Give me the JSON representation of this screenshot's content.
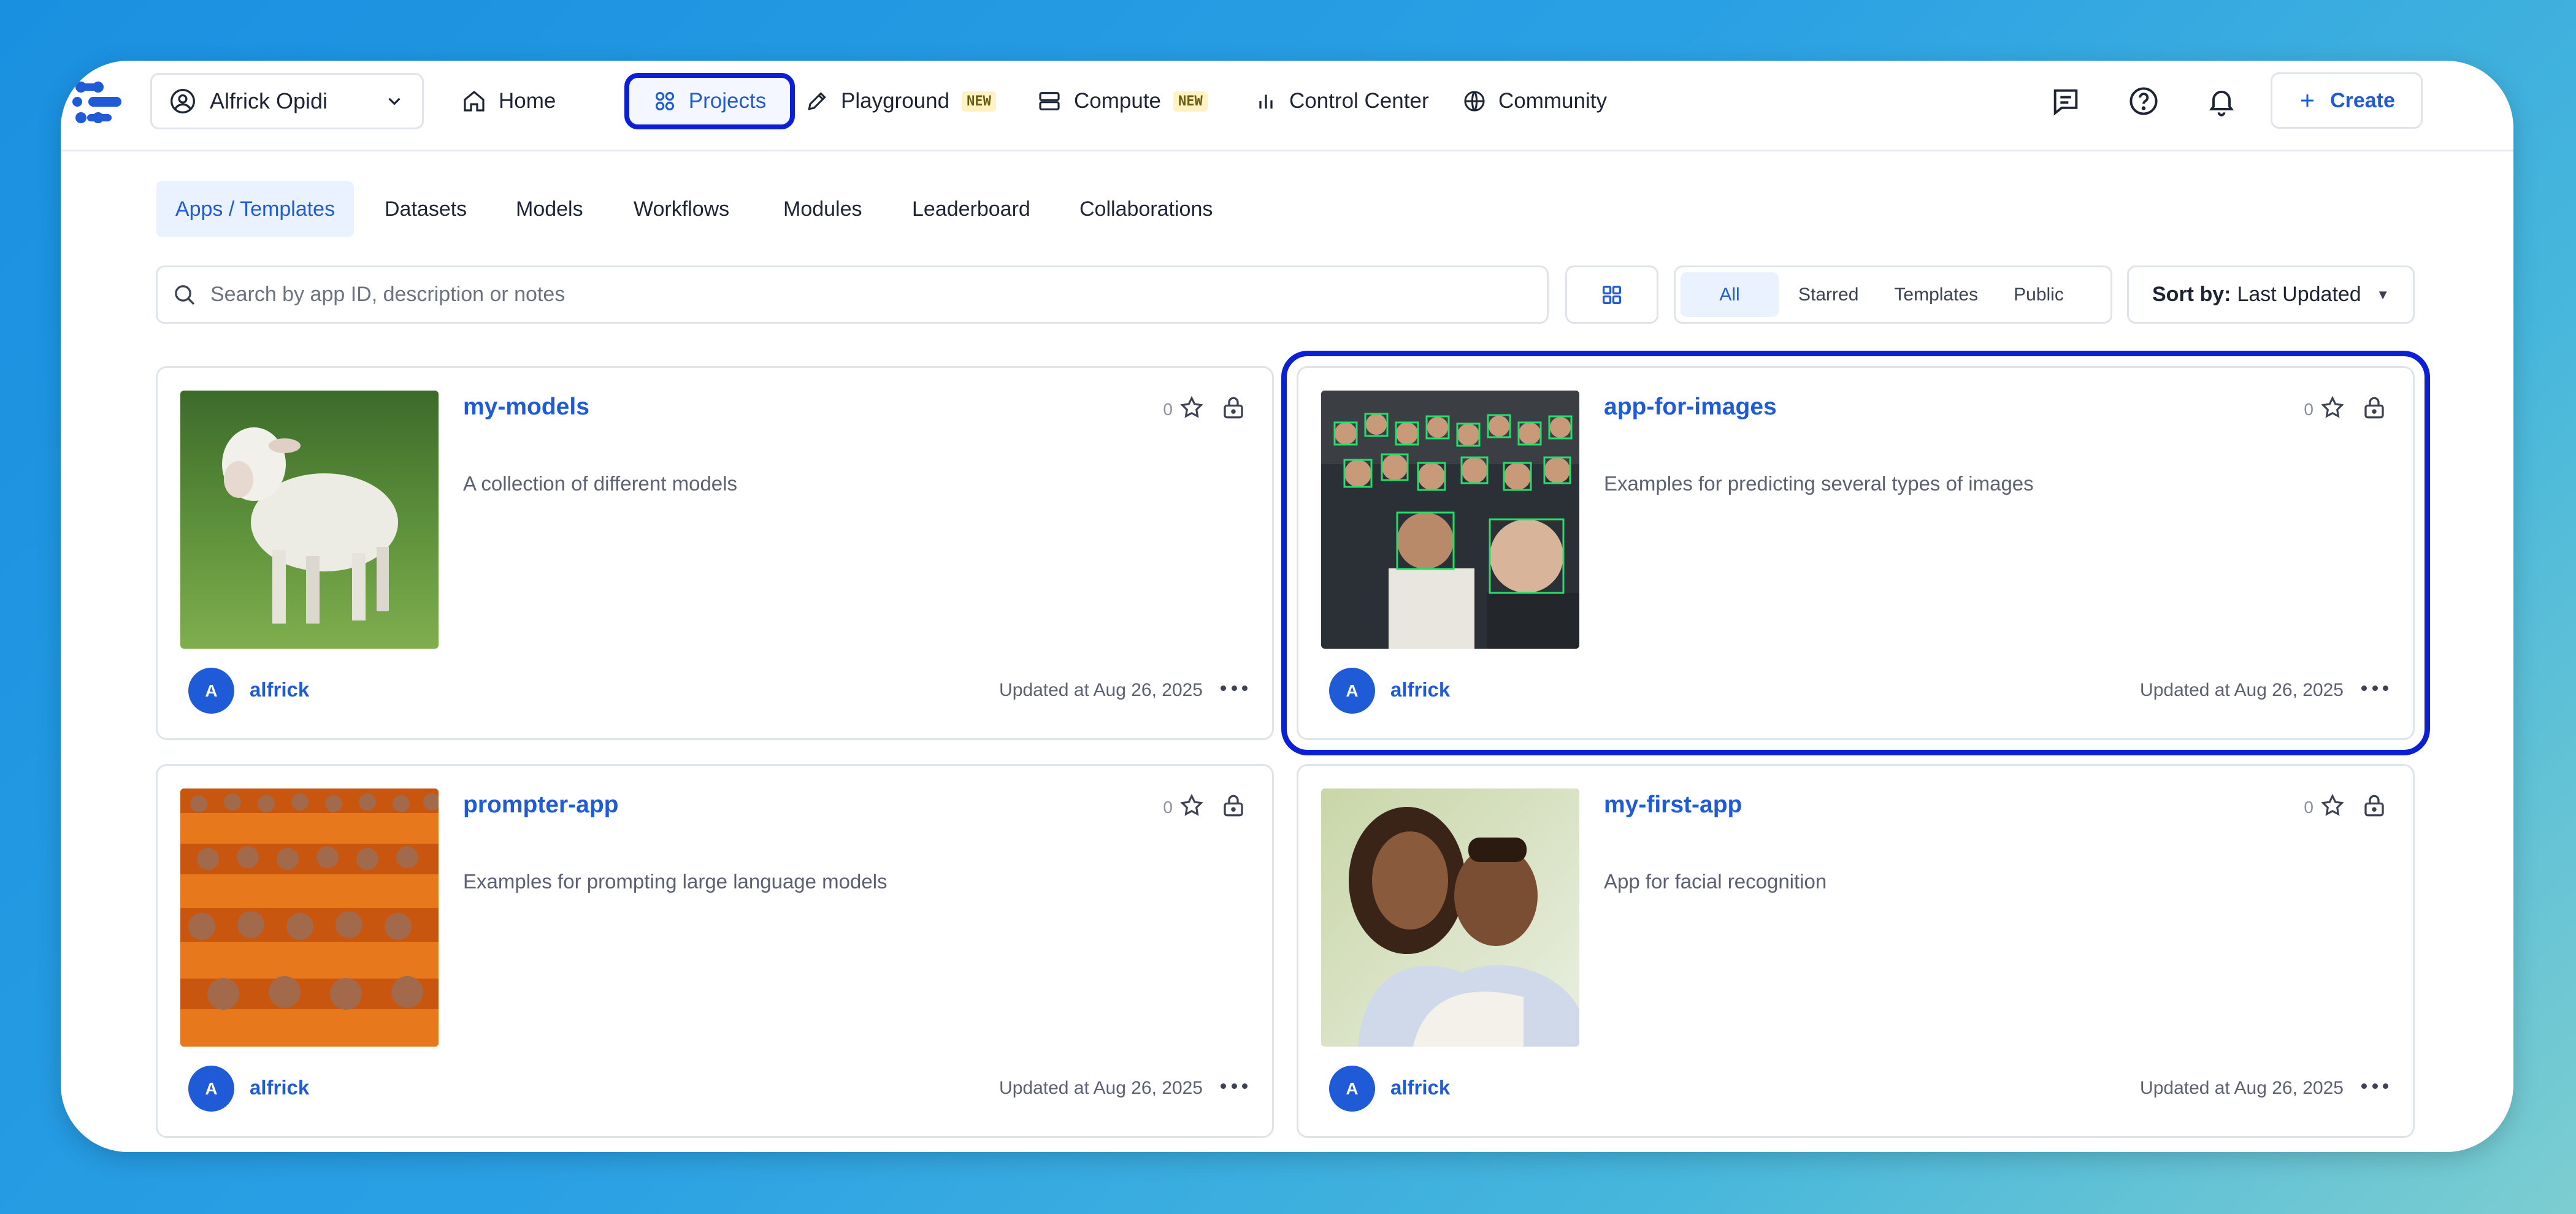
{
  "user_selector": {
    "name": "Alfrick Opidi"
  },
  "nav": {
    "home": "Home",
    "projects": "Projects",
    "playground": "Playground",
    "playground_badge": "NEW",
    "compute": "Compute",
    "compute_badge": "NEW",
    "control_center": "Control Center",
    "community": "Community"
  },
  "header_actions": {
    "create": "Create"
  },
  "subtabs": [
    "Apps / Templates",
    "Datasets",
    "Models",
    "Workflows",
    "Modules",
    "Leaderboard",
    "Collaborations"
  ],
  "search": {
    "placeholder": "Search by app ID, description or notes"
  },
  "filters": [
    "All",
    "Starred",
    "Templates",
    "Public"
  ],
  "sort": {
    "label": "Sort by:",
    "value": "Last Updated"
  },
  "colors": {
    "accent": "#1f5bd6",
    "highlight": "#0b1fd6"
  },
  "cards": [
    {
      "title": "my-models",
      "description": "A collection of different models",
      "stars": "0",
      "owner": "alfrick",
      "avatar": "A",
      "updated": "Updated at Aug 26, 2025"
    },
    {
      "title": "app-for-images",
      "description": "Examples for predicting several types of images",
      "stars": "0",
      "owner": "alfrick",
      "avatar": "A",
      "updated": "Updated at Aug 26, 2025"
    },
    {
      "title": "prompter-app",
      "description": "Examples for prompting large language models",
      "stars": "0",
      "owner": "alfrick",
      "avatar": "A",
      "updated": "Updated at Aug 26, 2025"
    },
    {
      "title": "my-first-app",
      "description": "App for facial recognition",
      "stars": "0",
      "owner": "alfrick",
      "avatar": "A",
      "updated": "Updated at Aug 26, 2025"
    }
  ]
}
